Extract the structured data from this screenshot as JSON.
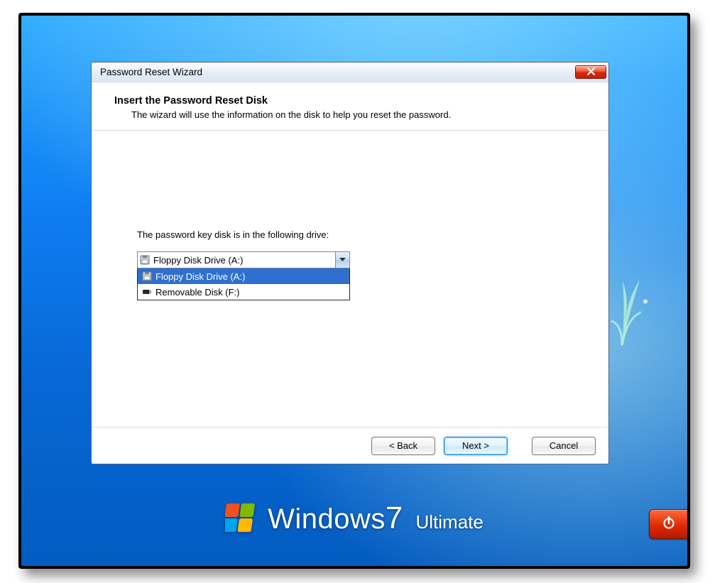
{
  "window_title": "Password Reset Wizard",
  "header": {
    "title": "Insert the Password Reset Disk",
    "subtitle": "The wizard will use the information on the disk to help you reset the password."
  },
  "body": {
    "prompt": "The password key disk is in the following drive:",
    "selected_drive": "Floppy Disk Drive (A:)",
    "drives": [
      {
        "label": "Floppy Disk Drive (A:)",
        "icon": "floppy",
        "selected": true
      },
      {
        "label": "Removable Disk (F:)",
        "icon": "usb",
        "selected": false
      }
    ]
  },
  "buttons": {
    "back": "< Back",
    "next": "Next >",
    "cancel": "Cancel"
  },
  "branding": {
    "product": "Windows",
    "version": "7",
    "edition": "Ultimate"
  }
}
